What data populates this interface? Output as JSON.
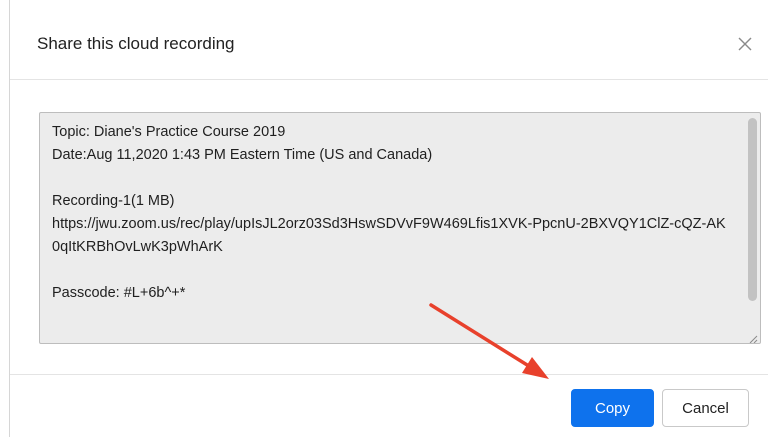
{
  "dialog": {
    "title": "Share this cloud recording",
    "close_icon": "close-icon"
  },
  "share_info": {
    "topic": "Topic: Diane's Practice Course 2019",
    "date": "Date:Aug 11,2020 1:43 PM Eastern Time (US and Canada)",
    "recording": "Recording-1(1 MB)",
    "url": "https://jwu.zoom.us/rec/play/upIsJL2orz03Sd3HswSDVvF9W469Lfis1XVK-PpcnU-2BXVQY1ClZ-cQZ-AK0qItKRBhOvLwK3pWhArK",
    "passcode": "Passcode: #L+6b^+*"
  },
  "buttons": {
    "copy_label": "Copy",
    "cancel_label": "Cancel"
  },
  "colors": {
    "primary": "#0e72ed",
    "annotation_arrow": "#e8412c",
    "text_area_bg": "#ececec"
  },
  "annotation": {
    "icon": "arrow-pointer-icon"
  }
}
